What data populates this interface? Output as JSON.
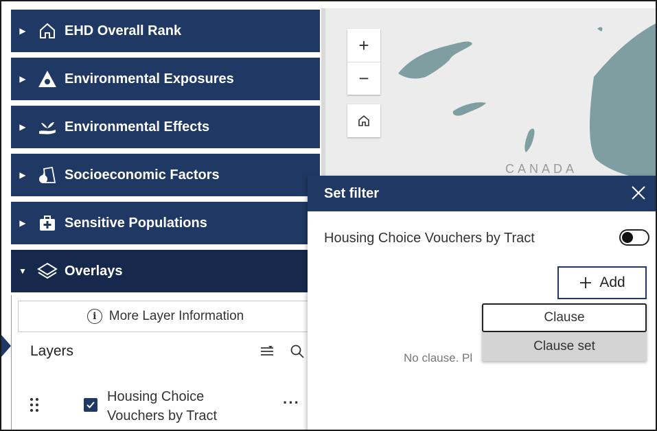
{
  "sidebar": {
    "items": [
      {
        "label": "EHD Overall Rank",
        "icon": "house-icon"
      },
      {
        "label": "Environmental Exposures",
        "icon": "hazard-icon"
      },
      {
        "label": "Environmental Effects",
        "icon": "hand-plant-icon"
      },
      {
        "label": "Socioeconomic Factors",
        "icon": "bag-apple-icon"
      },
      {
        "label": "Sensitive Populations",
        "icon": "medical-kit-icon"
      },
      {
        "label": "Overlays",
        "icon": "layers-icon"
      }
    ],
    "more_info_label": "More Layer Information",
    "layers_title": "Layers",
    "layer": {
      "name": "Housing Choice Vouchers by Tract",
      "checked": true
    }
  },
  "map": {
    "zoom_in": "+",
    "zoom_out": "−",
    "country_label": "CANADA"
  },
  "filter_dialog": {
    "title": "Set filter",
    "layer_name": "Housing Choice Vouchers by Tract",
    "add_label": "Add",
    "empty_text": "No clause. Pl",
    "menu": [
      "Clause",
      "Clause set"
    ]
  },
  "colors": {
    "accent": "#1f3864",
    "map_land": "#7f9ea1",
    "map_bg": "#ececec"
  }
}
